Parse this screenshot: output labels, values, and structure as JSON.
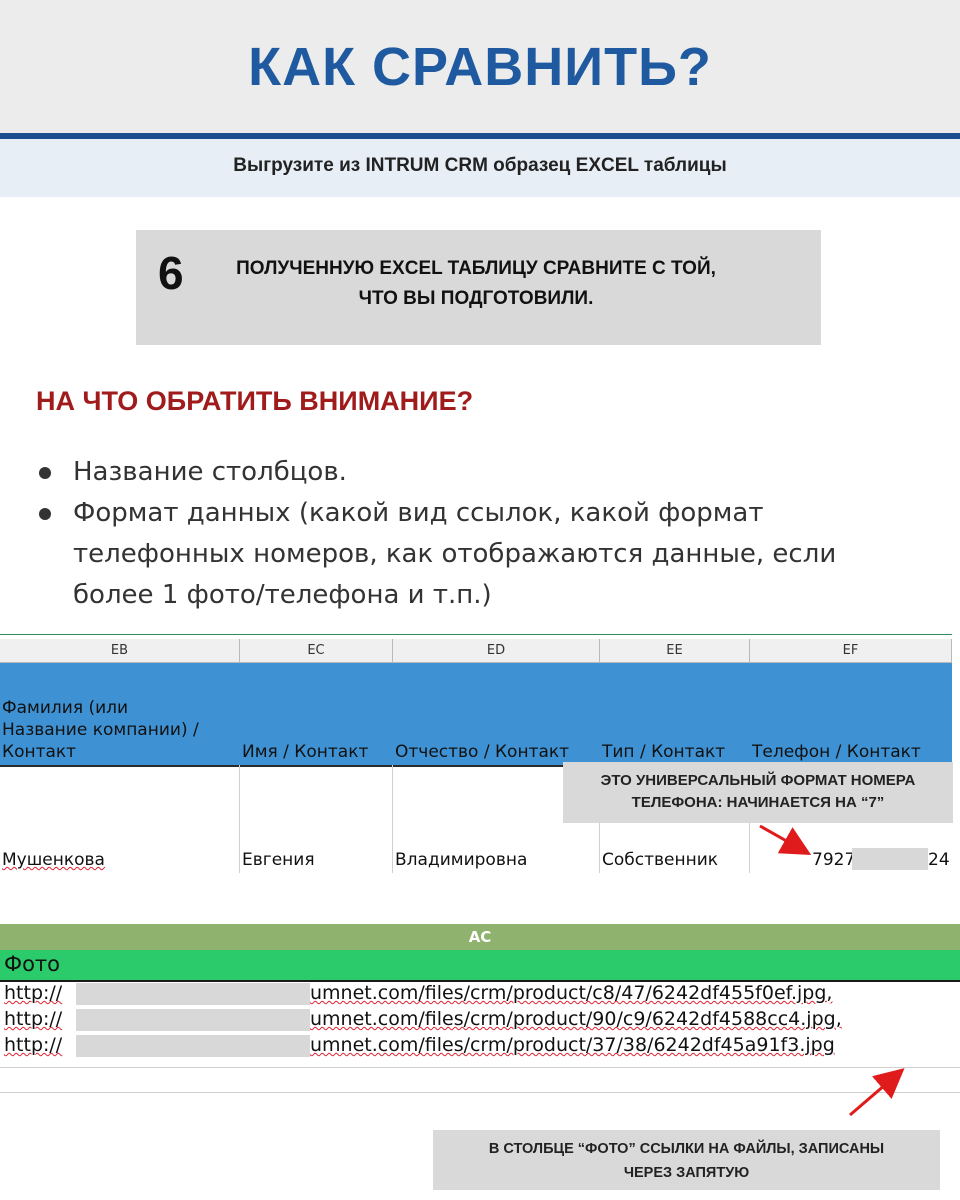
{
  "header": {
    "title": "КАК СРАВНИТЬ?",
    "subtitle": "Выгрузите из INTRUM CRM образец EXCEL таблицы"
  },
  "step": {
    "number": "6",
    "line1": "ПОЛУЧЕННУЮ EXCEL ТАБЛИЦУ СРАВНИТЕ С ТОЙ,",
    "line2": "ЧТО ВЫ ПОДГОТОВИЛИ."
  },
  "attention": {
    "heading": "НА ЧТО ОБРАТИТЬ ВНИМАНИЕ?",
    "bullets": [
      {
        "text": "Название столбцов."
      },
      {
        "lines": [
          "Формат данных (какой вид ссылок, какой формат",
          "телефонных номеров, как отображаются данные, если",
          "более 1 фото/телефона и т.п.)"
        ]
      }
    ]
  },
  "sheet1": {
    "columns": [
      "EB",
      "EC",
      "ED",
      "EE",
      "EF"
    ],
    "headers": {
      "col0": [
        "Фамилия (или",
        "Название компании) /",
        "Контакт"
      ],
      "col1": "Имя / Контакт",
      "col2": "Отчество / Контакт",
      "col3": "Тип / Контакт",
      "col4": "Телефон / Контакт"
    },
    "row": {
      "col0": "Мушенкова",
      "col1": "Евгения",
      "col2": "Владимировна",
      "col3": "Собственник",
      "phone_start": "7927",
      "phone_end": "24"
    },
    "callout": [
      "ЭТО УНИВЕРСАЛЬНЫЙ ФОРМАТ НОМЕРА",
      "ТЕЛЕФОНА: НАЧИНАЕТСЯ НА “7”"
    ],
    "arrow_color": "#e01b1b"
  },
  "sheet2": {
    "column": "AC",
    "header": "Фото",
    "lines": [
      {
        "start": "http://",
        "end": "umnet.com/files/crm/product/c8/47/6242df455f0ef.jpg,"
      },
      {
        "start": "http://",
        "end": "umnet.com/files/crm/product/90/c9/6242df4588cc4.jpg,"
      },
      {
        "start": "http://",
        "end": "umnet.com/files/crm/product/37/38/6242df45a91f3.jpg"
      }
    ],
    "callout": [
      "В СТОЛБЦЕ “ФОТО” ССЫЛКИ НА ФАЙЛЫ, ЗАПИСАНЫ",
      "ЧЕРЕЗ ЗАПЯТУЮ"
    ]
  },
  "colors": {
    "title_blue": "#1f5aa0",
    "attention_red": "#a01b1b",
    "header_blue": "#3e92d4",
    "header_green": "#2bca6a",
    "column_green": "#8fb36e"
  }
}
